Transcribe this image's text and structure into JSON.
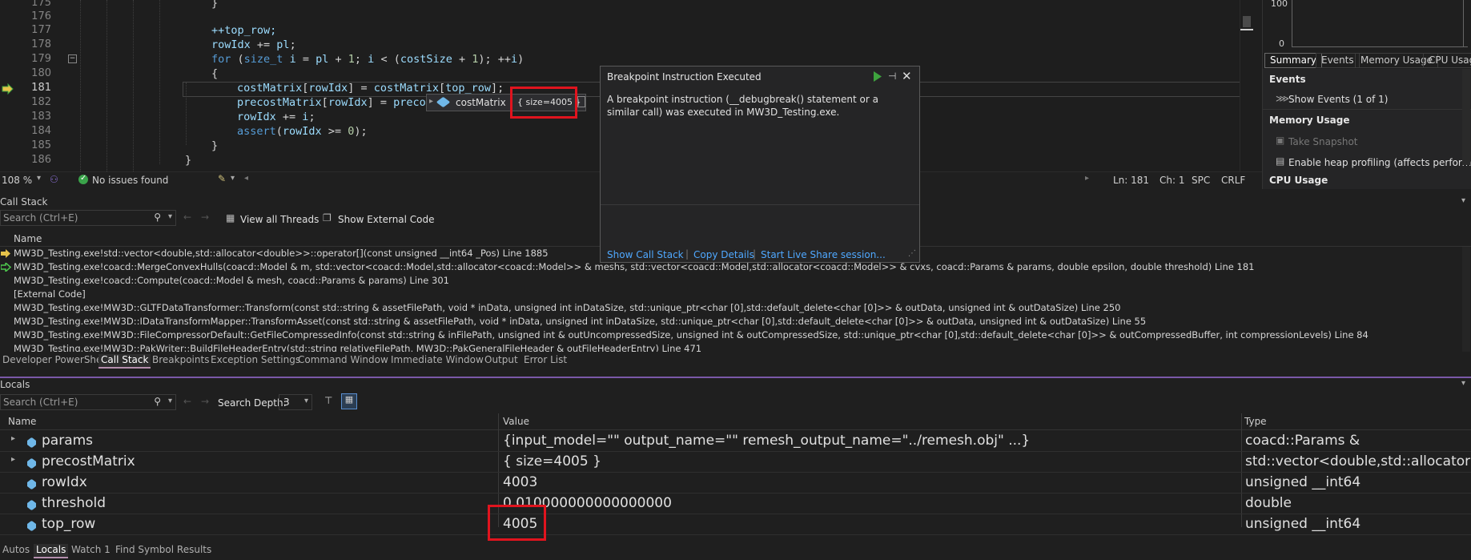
{
  "editor": {
    "lines": [
      {
        "num": "175",
        "text": "}"
      },
      {
        "num": "176",
        "text": ""
      },
      {
        "num": "177",
        "text": "++top_row;"
      },
      {
        "num": "178",
        "text": "rowIdx += pl;"
      },
      {
        "num": "179",
        "text": "for (size_t i = pl + 1; i < (costSize + 1); ++i)"
      },
      {
        "num": "180",
        "text": "{"
      },
      {
        "num": "181",
        "text": "costMatrix[rowIdx] = costMatrix[top_row];"
      },
      {
        "num": "182",
        "text": "precostMatrix[rowIdx] = preco"
      },
      {
        "num": "183",
        "text": "rowIdx += i;"
      },
      {
        "num": "184",
        "text": "assert(rowIdx >= 0);"
      },
      {
        "num": "185",
        "text": "}"
      },
      {
        "num": "186",
        "text": "}"
      }
    ],
    "datatip": {
      "name": "costMatrix",
      "value": "{ size=4005 }"
    },
    "status": {
      "zoom": "108 %",
      "issues": "No issues found",
      "ln": "Ln: 181",
      "ch": "Ch: 1",
      "spc": "SPC",
      "crlf": "CRLF"
    }
  },
  "diag": {
    "axis_top": "100",
    "axis_bottom": "0",
    "tabs": [
      "Summary",
      "Events",
      "Memory Usage",
      "CPU Usage"
    ],
    "events_header": "Events",
    "show_events": "Show Events (1 of 1)",
    "memory_header": "Memory Usage",
    "take_snapshot": "Take Snapshot",
    "heap_profiling": "Enable heap profiling (affects performance)",
    "cpu_header": "CPU Usage"
  },
  "popup": {
    "title": "Breakpoint Instruction Executed",
    "message": "A breakpoint instruction (__debugbreak() statement or a similar call) was executed in MW3D_Testing.exe.",
    "links": [
      "Show Call Stack",
      "Copy Details",
      "Start Live Share session..."
    ]
  },
  "callstack": {
    "title": "Call Stack",
    "search_placeholder": "Search (Ctrl+E)",
    "view_all_threads": "View all Threads",
    "show_external_code": "Show External Code",
    "column": "Name",
    "rows": [
      "MW3D_Testing.exe!std::vector<double,std::allocator<double>>::operator[](const unsigned __int64 _Pos) Line 1885",
      "MW3D_Testing.exe!coacd::MergeConvexHulls(coacd::Model & m, std::vector<coacd::Model,std::allocator<coacd::Model>> & meshs, std::vector<coacd::Model,std::allocator<coacd::Model>> & cvxs, coacd::Params & params, double epsilon, double threshold) Line 181",
      "MW3D_Testing.exe!coacd::Compute(coacd::Model & mesh, coacd::Params & params) Line 301",
      "[External Code]",
      "MW3D_Testing.exe!MW3D::GLTFDataTransformer::Transform(const std::string & assetFilePath, void * inData, unsigned int inDataSize, std::unique_ptr<char [0],std::default_delete<char [0]>> & outData, unsigned int & outDataSize) Line 250",
      "MW3D_Testing.exe!MW3D::IDataTransformMapper::TransformAsset(const std::string & assetFilePath, void * inData, unsigned int inDataSize, std::unique_ptr<char [0],std::default_delete<char [0]>> & outData, unsigned int & outDataSize) Line 55",
      "MW3D_Testing.exe!MW3D::FileCompressorDefault::GetFileCompressedInfo(const std::string & inFilePath, unsigned int & outUncompressedSize, unsigned int & outCompressedSize, std::unique_ptr<char [0],std::default_delete<char [0]>> & outCompressedBuffer, int compressionLevels) Line 84",
      "MW3D_Testing.exe!MW3D::PakWriter::BuildFileHeaderEntry(std::string relativeFilePath, MW3D::PakGeneralFileHeader & outFileHeaderEntry) Line 471"
    ],
    "tabs": [
      "Developer PowerShell",
      "Call Stack",
      "Breakpoints",
      "Exception Settings",
      "Command Window",
      "Immediate Window",
      "Output",
      "Error List"
    ]
  },
  "locals": {
    "title": "Locals",
    "search_placeholder": "Search (Ctrl+E)",
    "search_depth_label": "Search Depth:",
    "search_depth_value": "3",
    "columns": [
      "Name",
      "Value",
      "Type"
    ],
    "rows": [
      {
        "name": "params",
        "value": "{input_model=\"\" output_name=\"\" remesh_output_name=\"../remesh.obj\" ...}",
        "type": "coacd::Params &"
      },
      {
        "name": "precostMatrix",
        "value": "{ size=4005 }",
        "type": "std::vector<double,std::allocator<"
      },
      {
        "name": "rowIdx",
        "value": "4003",
        "type": "unsigned __int64"
      },
      {
        "name": "threshold",
        "value": "0.010000000000000000",
        "type": "double"
      },
      {
        "name": "top_row",
        "value": "4005",
        "type": "unsigned __int64"
      }
    ],
    "tabs": [
      "Autos",
      "Locals",
      "Watch 1",
      "Find Symbol Results"
    ]
  },
  "colors": {
    "highlight": "#e0141e",
    "link": "#4fa8ff",
    "accent": "#7a58a8"
  }
}
